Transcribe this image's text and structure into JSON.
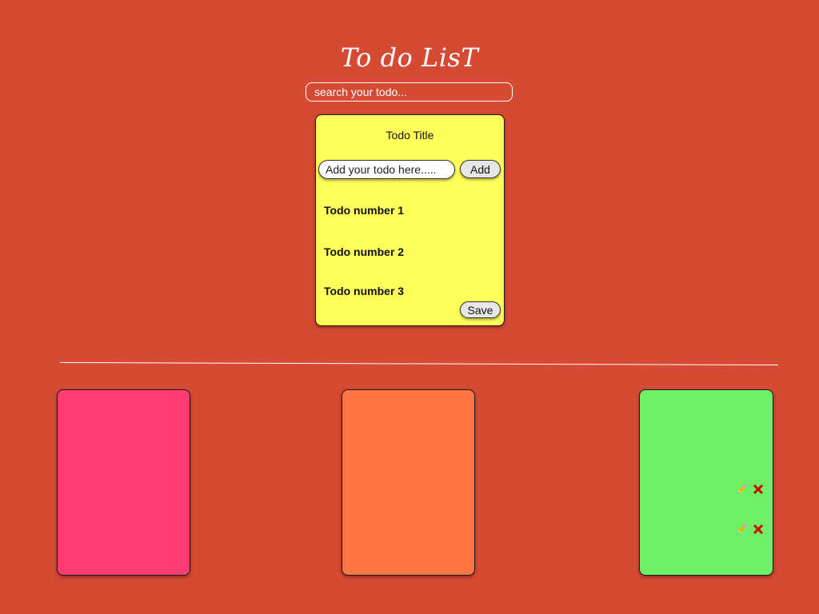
{
  "app": {
    "title": "To do LisT"
  },
  "search": {
    "placeholder": "search your todo..."
  },
  "editor": {
    "title": "Todo Title",
    "input_placeholder": "Add your todo here.....",
    "add_label": "Add",
    "items": [
      "Todo number 1",
      "Todo number 2",
      "Todo number 3"
    ],
    "save_label": "Save"
  },
  "notes": [
    {
      "color": "#FF3B74",
      "items": []
    },
    {
      "color": "#FF7544",
      "items": []
    },
    {
      "color": "#6DF065",
      "items": [
        {
          "edit_icon": "pencil-icon",
          "delete_icon": "close-icon"
        },
        {
          "edit_icon": "pencil-icon",
          "delete_icon": "close-icon"
        }
      ]
    }
  ],
  "colors": {
    "background": "#D64933",
    "editor_card": "#FFFF59",
    "text_on_background": "#FFFFFF",
    "delete_icon": "#D40000"
  }
}
